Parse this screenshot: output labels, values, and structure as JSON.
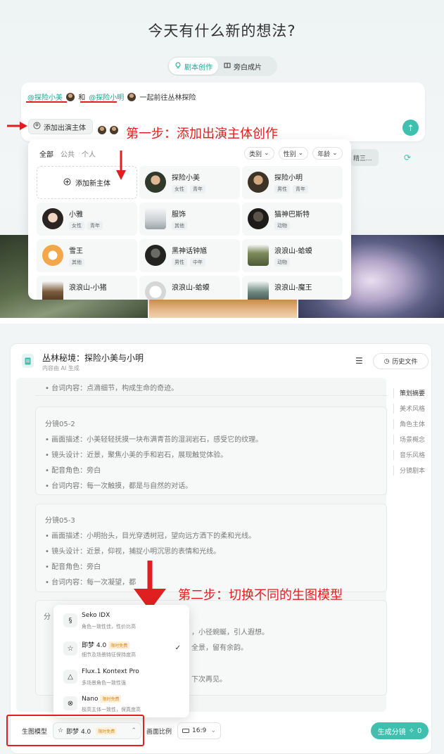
{
  "top": {
    "headline": "今天有什么新的想法?",
    "tabs": [
      {
        "label": "剧本创作",
        "icon": "bulb-icon",
        "active": true
      },
      {
        "label": "旁白成片",
        "icon": "book-icon",
        "active": false
      }
    ],
    "prompt": {
      "mention1": "@探险小美",
      "connector": "和",
      "mention2": "@探险小明",
      "rest": "一起前往丛林探险"
    },
    "add_cast_label": "添加出演主体",
    "step1_annotation": "第一步：添加出演主体创作",
    "ghost_chip": "精三...",
    "dropdown": {
      "filter_tabs": [
        "全部",
        "公共",
        "个人"
      ],
      "filters": [
        "类别",
        "性别",
        "年龄"
      ],
      "add_new_label": "添加新主体",
      "cells": [
        {
          "name": "探险小美",
          "tags": [
            "女性",
            "青年"
          ]
        },
        {
          "name": "探险小明",
          "tags": [
            "男性",
            "青年"
          ]
        },
        {
          "name": "小雅",
          "tags": [
            "女性",
            "青年"
          ]
        },
        {
          "name": "服饰",
          "tags": [
            "其他"
          ]
        },
        {
          "name": "猫神巴斯特",
          "tags": [
            "动物"
          ]
        },
        {
          "name": "雪王",
          "tags": [
            "其他"
          ]
        },
        {
          "name": "黑神话钟馗",
          "tags": [
            "男性",
            "中年"
          ]
        },
        {
          "name": "浪浪山-蛤蟆",
          "tags": [
            "动物"
          ]
        },
        {
          "name": "浪浪山-小猪",
          "tags": []
        },
        {
          "name": "浪浪山-蛤蟆",
          "tags": []
        },
        {
          "name": "浪浪山-魔王",
          "tags": []
        }
      ]
    }
  },
  "bottom": {
    "doc_title": "丛林秘境：探险小美与小明",
    "doc_sub": "内容由 AI 生成",
    "history_label": "历史文件",
    "toc": [
      "策划摘要",
      "美术风格",
      "角色主体",
      "场景概念",
      "音乐风格",
      "分镜剧本"
    ],
    "top_line": "台词内容：点滴细节，构成生命的奇迹。",
    "shots": [
      {
        "title": "分镜05-2",
        "lines": [
          "画面描述：小美轻轻抚摸一块布满青苔的湿润岩石，感受它的纹理。",
          "镜头设计：近景，聚焦小美的手和岩石，展现触觉体验。",
          "配音角色：旁白",
          "台词内容：每一次触摸，都是与自然的对话。"
        ]
      },
      {
        "title": "分镜05-3",
        "lines": [
          "画面描述：小明抬头，目光穿透树冠，望向远方洒下的柔和光线。",
          "镜头设计：近景，仰视，捕捉小明沉思的表情和光线。",
          "配音角色：旁白",
          "台词内容：每一次凝望，都"
        ]
      }
    ],
    "shot4_title": "分",
    "shot4_partials": [
      "，小径蜿蜒，引人遐想。",
      "全景，留有余韵。",
      "下次再见。"
    ],
    "step2_annotation": "第二步：切换不同的生图模型",
    "models": [
      {
        "name": "Seko IDX",
        "desc": "角色一致性佳，性价比高",
        "badge": ""
      },
      {
        "name": "即梦 4.0",
        "desc": "细节及场景特征保持度高",
        "badge": "限时免费",
        "selected": true
      },
      {
        "name": "Flux.1 Kontext Pro",
        "desc": "多场景角色一致性强",
        "badge": ""
      },
      {
        "name": "Nano",
        "desc": "极高主体一致性，保真度高",
        "badge": "限时免费"
      }
    ],
    "footer": {
      "model_label": "生图模型",
      "model_value": "即梦 4.0",
      "model_badge": "限时免费",
      "ratio_label": "画面比例",
      "ratio_value": "16:9",
      "generate_label": "生成分镜",
      "generate_count": "0"
    }
  }
}
